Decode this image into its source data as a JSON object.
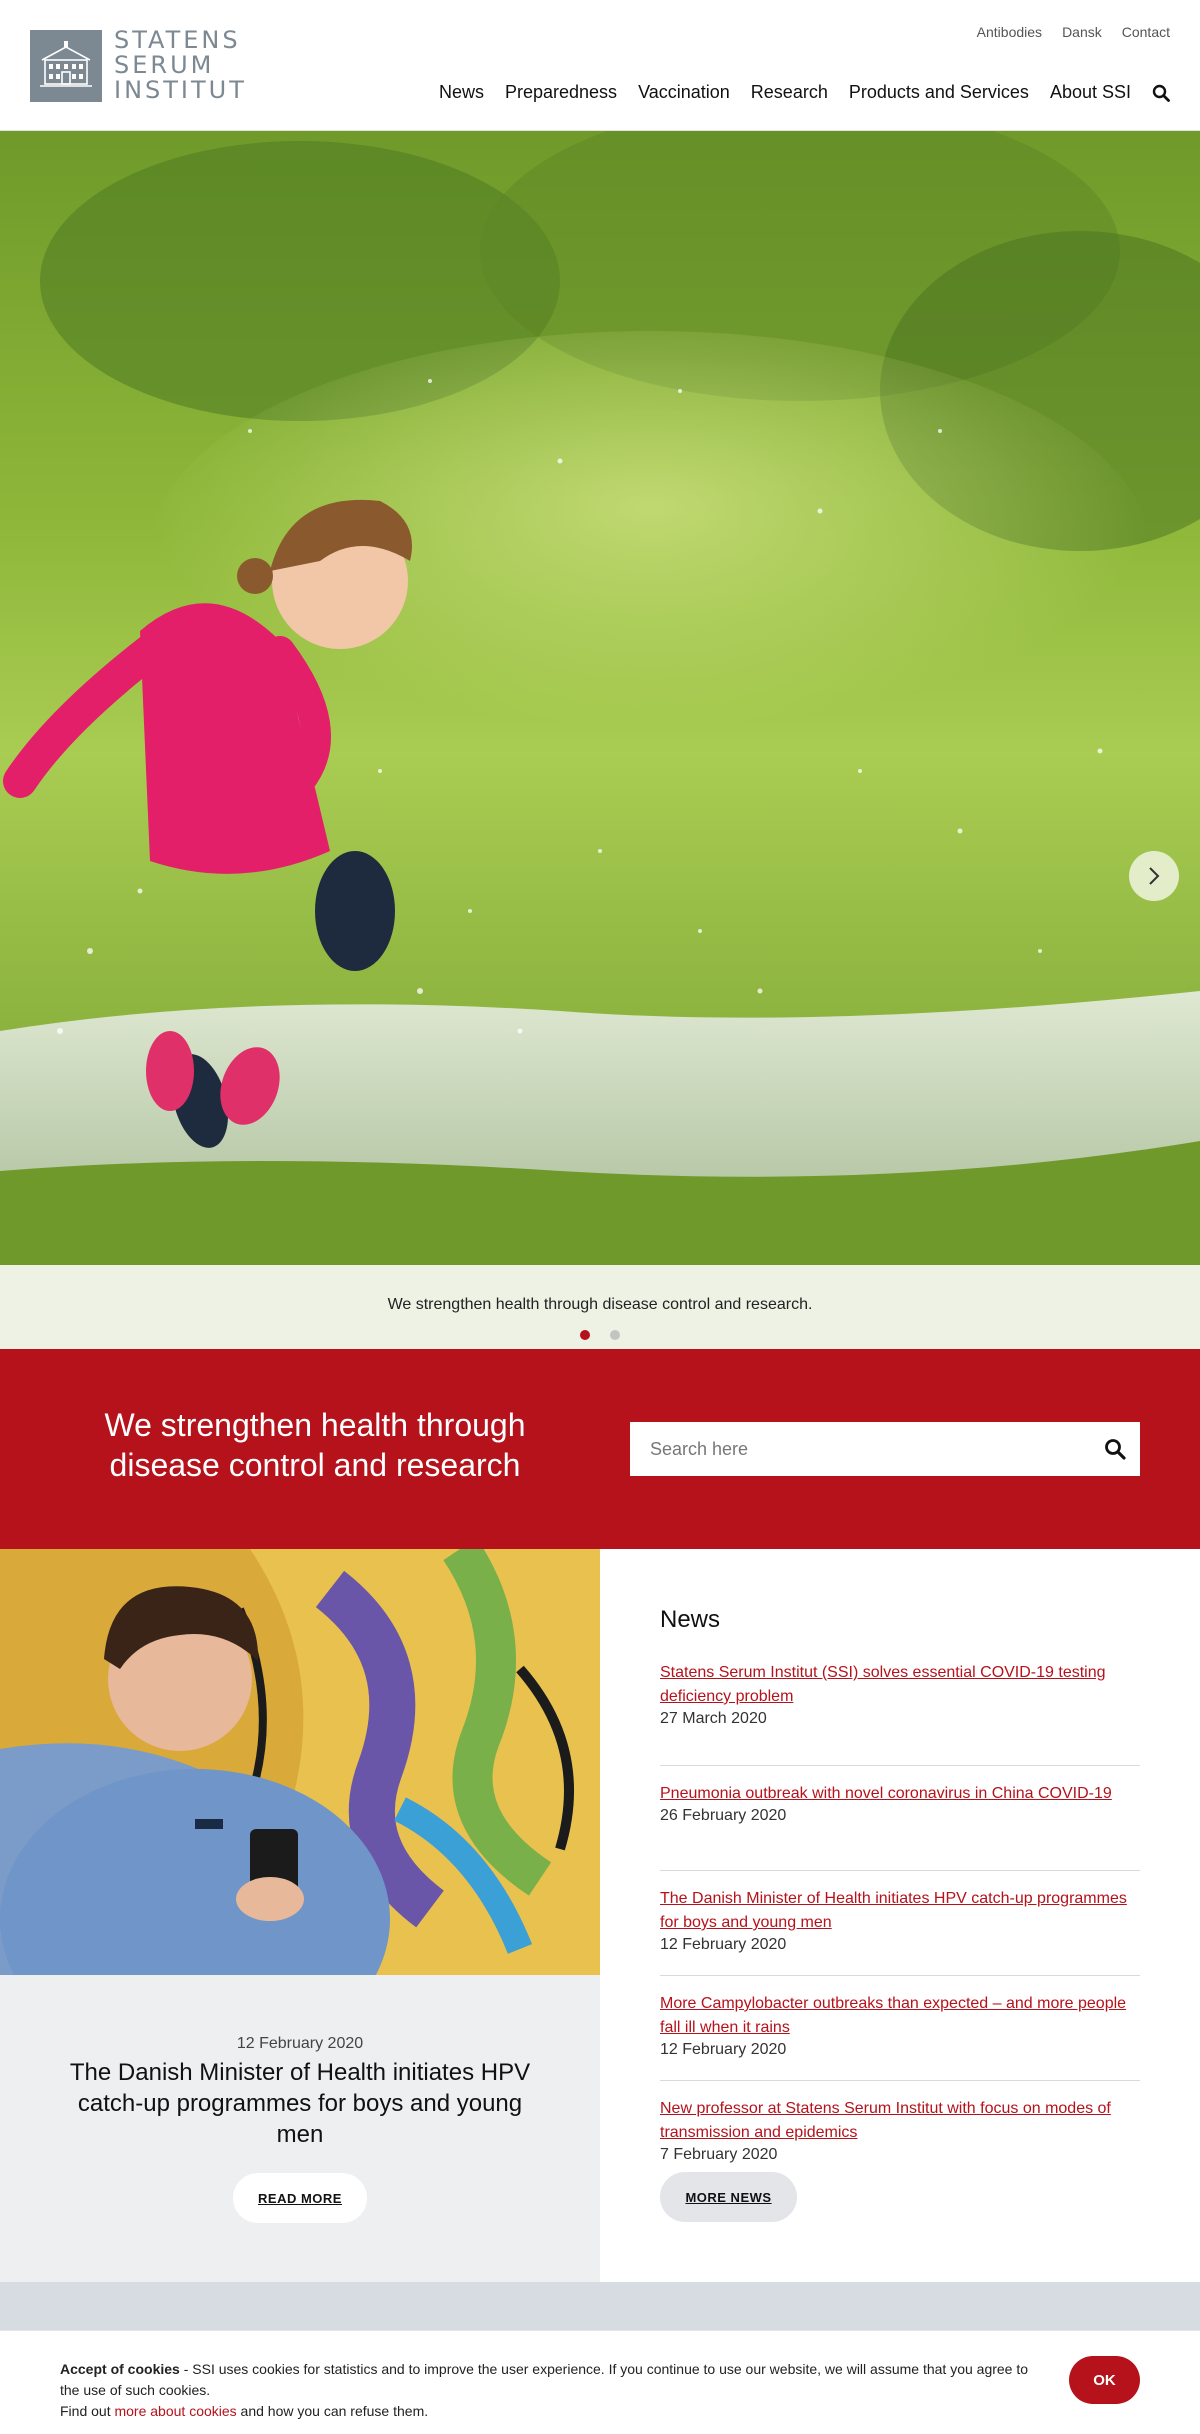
{
  "header": {
    "logo_lines": [
      "STATENS",
      "SERUM",
      "INSTITUT"
    ],
    "util_nav": [
      "Antibodies",
      "Dansk",
      "Contact"
    ],
    "main_nav": [
      "News",
      "Preparedness",
      "Vaccination",
      "Research",
      "Products and Services",
      "About SSI"
    ],
    "search_icon": "search-icon"
  },
  "hero": {
    "caption": "We strengthen health through disease control and research.",
    "slides": 2,
    "active_slide": 1,
    "next_icon": "chevron-right-icon"
  },
  "band": {
    "title": "We strengthen health through disease control and research",
    "search_placeholder": "Search here",
    "search_icon": "search-icon"
  },
  "feature": {
    "date": "12 February 2020",
    "title": "The Danish Minister of Health initiates HPV catch-up programmes for boys and young men",
    "button_label": "READ MORE"
  },
  "news": {
    "heading": "News",
    "items": [
      {
        "title": "Statens Serum Institut (SSI) solves essential COVID-19 testing deficiency problem",
        "date": "27 March 2020"
      },
      {
        "title": "Pneumonia outbreak with novel coronavirus in China COVID-19",
        "date": "26 February 2020"
      },
      {
        "title": "The Danish Minister of Health initiates HPV catch-up programmes for boys and young men",
        "date": "12 February 2020"
      },
      {
        "title": "More Campylobacter outbreaks than expected – and more people fall ill when it rains",
        "date": "12 February 2020"
      },
      {
        "title": "New professor at Statens Serum Institut with focus on modes of transmission and epidemics",
        "date": "7 February 2020"
      }
    ],
    "more_label": "MORE NEWS"
  },
  "cookie": {
    "title": "Accept of cookies",
    "text": " - SSI uses cookies for statistics and to improve the user experience. If you continue to use our website, we will assume that you agree to the use of such cookies.",
    "find_out": "Find out ",
    "link_text": "more about cookies",
    "tail": " and how you can refuse them.",
    "ok_label": "OK"
  },
  "colors": {
    "brand_red": "#b5121b",
    "logo_grey": "#7c8892"
  }
}
